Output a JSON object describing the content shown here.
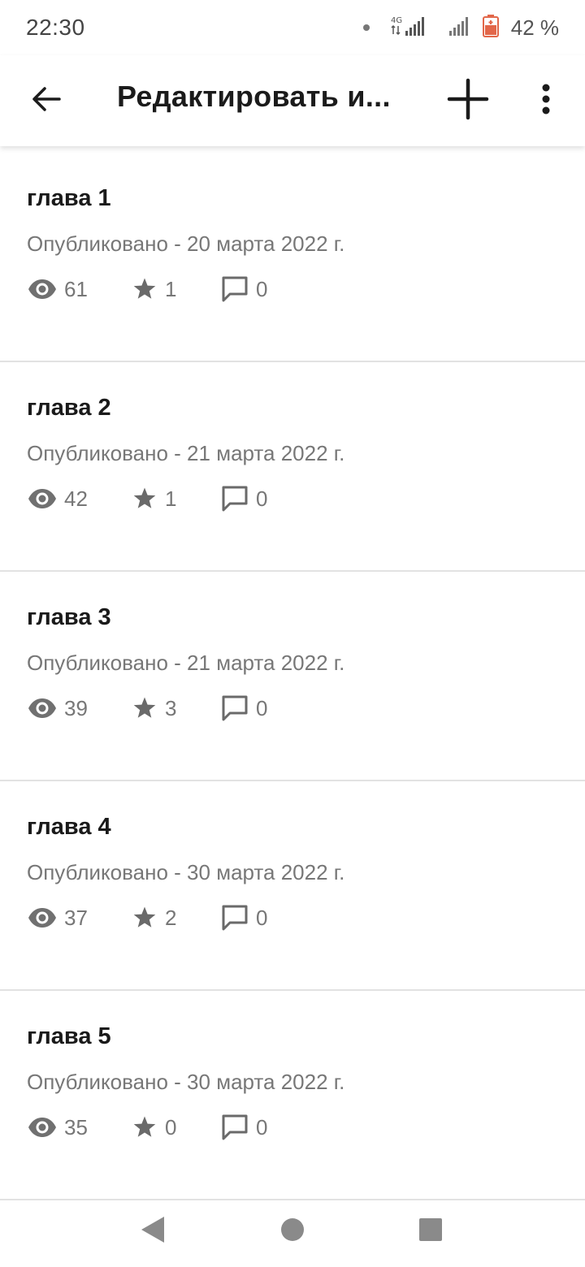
{
  "status_bar": {
    "time": "22:30",
    "network": "4G",
    "battery": "42 %"
  },
  "toolbar": {
    "title": "Редактировать и...",
    "back_icon": "arrow-back-icon",
    "add_icon": "plus-icon",
    "more_icon": "more-vertical-icon"
  },
  "chapters": [
    {
      "title": "глава 1",
      "meta": "Опубликовано - 20 марта 2022 г.",
      "views": "61",
      "votes": "1",
      "comments": "0"
    },
    {
      "title": "глава 2",
      "meta": "Опубликовано - 21 марта 2022 г.",
      "views": "42",
      "votes": "1",
      "comments": "0"
    },
    {
      "title": "глава 3",
      "meta": "Опубликовано - 21 марта 2022 г.",
      "views": "39",
      "votes": "3",
      "comments": "0"
    },
    {
      "title": "глава 4",
      "meta": "Опубликовано - 30 марта 2022 г.",
      "views": "37",
      "votes": "2",
      "comments": "0"
    },
    {
      "title": "глава 5",
      "meta": "Опубликовано - 30 марта 2022 г.",
      "views": "35",
      "votes": "0",
      "comments": "0"
    }
  ],
  "colors": {
    "text_primary": "#1a1a1a",
    "text_secondary": "#777777",
    "divider": "#e2e2e2",
    "battery_accent": "#e2674a"
  }
}
